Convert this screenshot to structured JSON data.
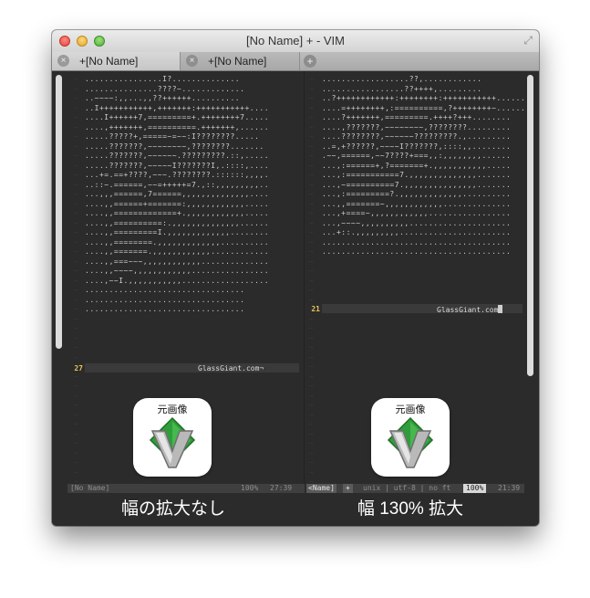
{
  "window": {
    "title": "[No Name] + - VIM"
  },
  "tabs": [
    {
      "label": "+[No Name]",
      "close": "×"
    },
    {
      "label": "+[No Name]",
      "close": "×"
    }
  ],
  "new_tab_symbol": "+",
  "left_pane": {
    "ascii_art": "................I?..............\n...............????~.............\n..~~~~:,,...,,??++++++..........\n..I+++++++++++,+++++++:+++++++++++....\n....I++++++7,=========+.++++++++7.....\n....,+++++++,==========.+++++++,......\n.....?????+,=====~=~~:I????????.....\n.....???????,~~~~~~~~,????????.......\n.....???????,~~~~~~.?????????.::,.....\n.....???????,~~~~~I???????I,.::::,....\n...+=.==+????,~~~.????????.::::::,,,,.\n..::~.======,~~=+++++=7.,::,,,,,,,,,..\n...,,,======,7======,,,,,,,,,,,,,,....\n....,,======+=======:,,,,,,,,,,,,.....\n....,,=============+.,,,,,,,,,,,,.....\n....,,==========:.,,,,,,,,,,,,,,......\n....,,=========I.,,,,,,,,,,,,,........\n....,,========.,,,,,,,,,,,,,..........\n....,,=======.,,,,,,,,,,,,............\n....,,===~~~,,,,,,,,,,,,..............\n....,,~~~~,,,,,,,,,,,,................\n....,~~I.,,,,,,,,,,,..................\n.................................\n.................................\n.................................",
    "line_number": "27",
    "credit": "GlassGiant.com",
    "icon_label": "元画像",
    "caption": "幅の拡大なし"
  },
  "right_pane": {
    "ascii_art": "..................??,............\n.................??++++,.........\n..?++++++++++++:++++++++:+++++++++++......\n....=++++++++,:==========,?++++++++~.......\n....?+++++++,=========.++++?+++........\n....,???????,~~~~~~~~,????????.........\n....????????,~~~~~~?????????.,.........\n..=,+??????,~~~~I???????,::::,,........\n.~~,======,~~7????+===,,:,,,,,,,,......\n...,:======+,?=======+.,,,,,,,,,,,.....\n...,:===========7.,,,,,,,,,,,,,,.......\n...,~==========7.,,,,,,,,,,,,,,,.......\n...,:=========?.,,,,,,,,,,,,,..........\n...,,=======~,,,,,,,,,,,,..............\n...,+====~,,,,,,,,,,,,.................\n...,~~~~,,,,,,,,,,.....................\n...+::.,,,,,,,,,.......................\n.......................................\n.......................................",
    "line_number": "21",
    "credit": "GlassGiant.com",
    "icon_label": "元画像",
    "caption": "幅 130% 拡大"
  },
  "statusbar": {
    "left_name": "[No Name]",
    "left_pct": "100%",
    "left_pos": "27:39",
    "right_name": "<Name]",
    "right_modified": "+",
    "right_info": "unix | utf-8 | no ft",
    "right_pct": "100%",
    "right_pos": "21:39"
  },
  "colors": {
    "background": "#2b2b2b",
    "line_number_current": "#e6c45a",
    "vim_green": "#2f9e3a"
  },
  "icons": [
    "close-icon",
    "minimize-icon",
    "zoom-icon",
    "fullscreen-icon",
    "add-tab-icon",
    "vim-logo-icon"
  ]
}
